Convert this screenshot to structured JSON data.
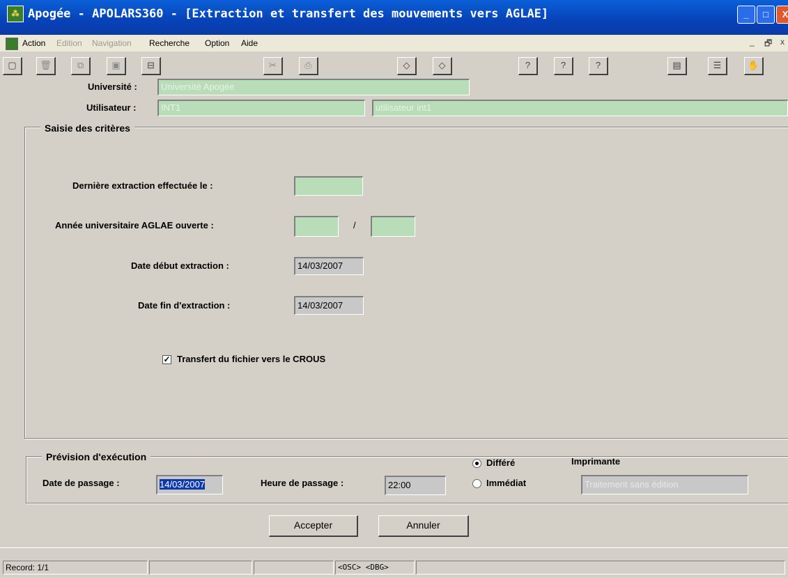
{
  "window": {
    "title": "Apogée - APOLARS360 - [Extraction et transfert des mouvements vers AGLAE]",
    "controls": {
      "min": "_",
      "max": "□",
      "close": "X"
    }
  },
  "menu": {
    "items": [
      {
        "label": "Action",
        "enabled": true
      },
      {
        "label": "Edition",
        "enabled": false
      },
      {
        "label": "Navigation",
        "enabled": false
      },
      {
        "label": "Recherche",
        "enabled": true
      },
      {
        "label": "Option",
        "enabled": true
      },
      {
        "label": "Aide",
        "enabled": true
      }
    ],
    "mdi_controls": {
      "min": "_",
      "restore": "🗗",
      "close": "x"
    }
  },
  "toolbar": {
    "icons": [
      "new-icon",
      "delete-icon",
      "copy-icon",
      "save-icon",
      "form-icon",
      "cut-icon",
      "print-icon",
      "prev-icon",
      "next-icon",
      "help-context-icon",
      "help-icon",
      "help-plus-icon",
      "calculator-icon",
      "list-icon",
      "hand-icon"
    ]
  },
  "header": {
    "universite_label": "Université :",
    "universite_value": "Université Apogée",
    "utilisateur_label": "Utilisateur :",
    "utilisateur_code": "INT1",
    "utilisateur_name": "utilisateur int1"
  },
  "criteres": {
    "title": "Saisie des critères",
    "derniere_label": "Dernière extraction effectuée le :",
    "derniere_value": "",
    "annee_label": "Année universitaire AGLAE ouverte :",
    "annee_start": "",
    "annee_sep": "/",
    "annee_end": "",
    "date_debut_label": "Date début extraction :",
    "date_debut_value": "14/03/2007",
    "date_fin_label": "Date fin d'extraction :",
    "date_fin_value": "14/03/2007",
    "transfert_label": "Transfert du fichier vers le CROUS",
    "transfert_checked": "✓"
  },
  "prevision": {
    "title": "Prévision d'exécution",
    "date_label": "Date de passage :",
    "date_value": "14/03/2007",
    "heure_label": "Heure de passage :",
    "heure_value": "22:00",
    "differe_label": "Différé",
    "immediat_label": "Immédiat",
    "mode_selected": "Différé",
    "imprimante_label": "Imprimante",
    "imprimante_value": "Traitement sans édition"
  },
  "buttons": {
    "accept": "Accepter",
    "cancel": "Annuler"
  },
  "status": {
    "record": "Record: 1/1",
    "osc_dbg": "<OSC> <DBG>"
  }
}
